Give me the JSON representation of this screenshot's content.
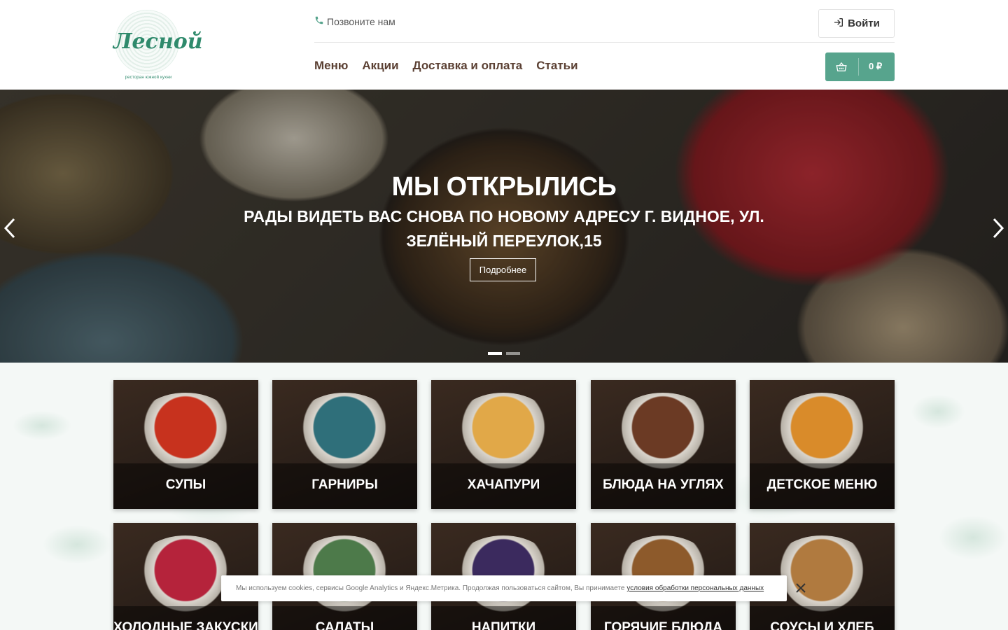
{
  "header": {
    "logo_name": "Лесной",
    "logo_tagline": "ресторан южной кухни",
    "call_label": "Позвоните нам",
    "login_label": "Войти",
    "nav": [
      "Меню",
      "Акции",
      "Доставка и оплата",
      "Статьи"
    ],
    "cart_total": "0 ₽"
  },
  "hero": {
    "title": "МЫ ОТКРЫЛИСЬ",
    "subtitle": "РАДЫ ВИДЕТЬ ВАС СНОВА ПО НОВОМУ АДРЕСУ Г. ВИДНОЕ, УЛ. ЗЕЛЁНЫЙ ПЕРЕУЛОК,15",
    "button": "Подробнее",
    "slide_count": 2,
    "active_slide": 1
  },
  "categories": [
    {
      "label": "СУПЫ",
      "color": "#c7321e"
    },
    {
      "label": "ГАРНИРЫ",
      "color": "#2f6f7a"
    },
    {
      "label": "ХАЧАПУРИ",
      "color": "#e1a848"
    },
    {
      "label": "БЛЮДА НА УГЛЯХ",
      "color": "#6b3a24"
    },
    {
      "label": "ДЕТСКОЕ МЕНЮ",
      "color": "#d98b2a"
    },
    {
      "label": "ХОЛОДНЫЕ ЗАКУСКИ",
      "color": "#b5233b"
    },
    {
      "label": "САЛАТЫ",
      "color": "#4d7a4a"
    },
    {
      "label": "НАПИТКИ",
      "color": "#3b2a5e"
    },
    {
      "label": "ГОРЯЧИЕ БЛЮДА",
      "color": "#8d5a2b"
    },
    {
      "label": "СОУСЫ И ХЛЕБ",
      "color": "#b07a3f"
    }
  ],
  "cookie": {
    "text": "Мы используем cookies, сервисы Google Analytics и Яндекс.Метрика. Продолжая пользоваться сайтом, Вы принимаете",
    "link": "условия обработки персональных данных"
  },
  "colors": {
    "accent": "#57a48d",
    "nav": "#5b4033"
  }
}
